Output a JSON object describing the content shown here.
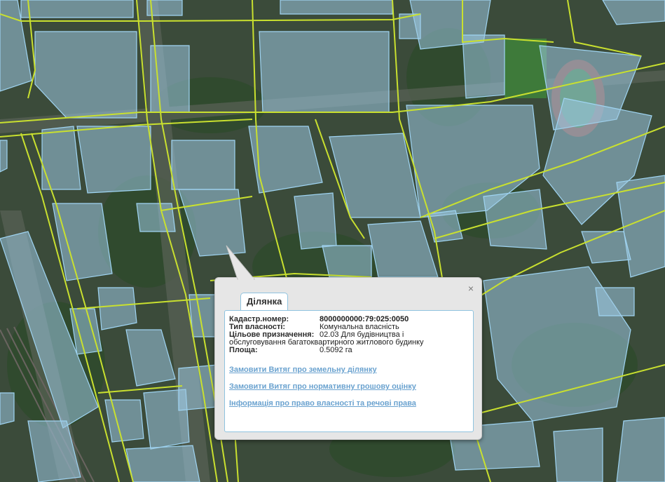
{
  "map": {
    "colors": {
      "parcel_fill": "#9cc8e2",
      "parcel_stroke": "#9fd4f2",
      "road_line": "#c9e02f",
      "aerial_base": "#3b4b3a"
    }
  },
  "popup": {
    "tab_label": "Ділянка",
    "close_icon": "×",
    "fields": [
      {
        "label": "Кадастр.номер:",
        "value": "8000000000:79:025:0050"
      },
      {
        "label": "Тип власності:",
        "value": "Комунальна власність"
      },
      {
        "label": "Цільове призначення:",
        "value": "02.03 Для будівництва і"
      },
      {
        "label": "",
        "value": "обслуговування багатоквартирного житлового будинку"
      },
      {
        "label": "Площа:",
        "value": "0.5092 га"
      }
    ],
    "links": [
      "Замовити Витяг про земельну ділянку",
      "Замовити Витяг про нормативну грошову оцінку",
      "Інформація про право власності та речові права"
    ]
  }
}
